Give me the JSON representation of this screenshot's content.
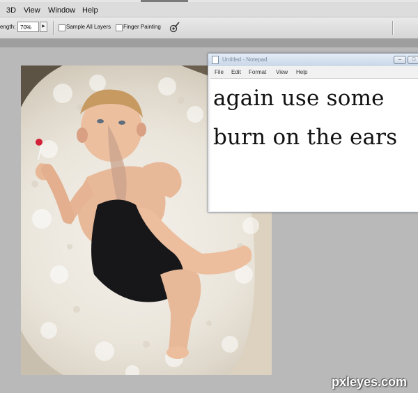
{
  "menubar": {
    "items": [
      "3D",
      "View",
      "Window",
      "Help"
    ]
  },
  "options": {
    "strength_label": "ength:",
    "strength_value": "70%",
    "sample_all_layers": "Sample All Layers",
    "finger_painting": "Finger Painting"
  },
  "notepad": {
    "title": "Untitled - Notepad",
    "menu": [
      "File",
      "Edit",
      "Format",
      "View",
      "Help"
    ],
    "lines": [
      "again use some",
      "burn on the ears"
    ]
  },
  "watermark": "pxleyes.com"
}
